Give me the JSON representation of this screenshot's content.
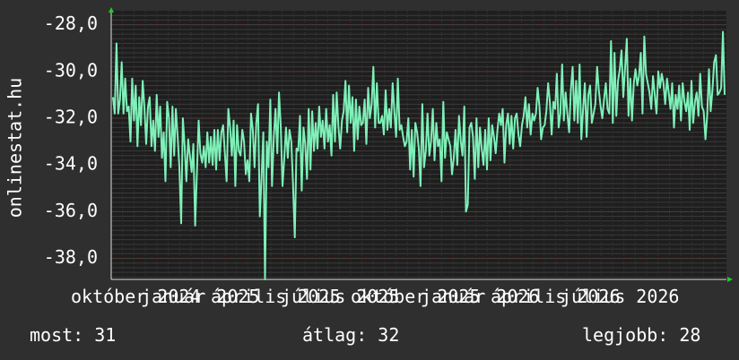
{
  "chart_data": {
    "type": "line",
    "ylabel": "onlinestat.hu",
    "ylim": [
      -38.9,
      -27.4
    ],
    "yticks": [
      -28.0,
      -30.0,
      -32.0,
      -34.0,
      -36.0,
      -38.0
    ],
    "ytick_labels": [
      "-28,0",
      "-30,0",
      "-32,0",
      "-34,0",
      "-36,0",
      "-38,0"
    ],
    "xtick_labels": [
      "október 2024",
      "január 2025",
      "április 2025",
      "július 2025",
      "október 2025",
      "január 2026",
      "április 2026",
      "július 2026"
    ],
    "grid": true,
    "series": [
      {
        "color": "#7ef0b8",
        "values": [
          -31.1,
          -31.8,
          -28.8,
          -31.8,
          -31.2,
          -29.6,
          -31.8,
          -30.3,
          -31.7,
          -31.5,
          -33.0,
          -30.3,
          -32.1,
          -30.6,
          -33.2,
          -31.1,
          -32.3,
          -30.4,
          -31.6,
          -33.1,
          -31.5,
          -31.1,
          -33.2,
          -32.1,
          -33.4,
          -31.0,
          -32.8,
          -31.5,
          -33.7,
          -32.6,
          -34.7,
          -31.3,
          -32.0,
          -34.1,
          -31.5,
          -33.6,
          -31.6,
          -32.8,
          -34.1,
          -36.5,
          -32.0,
          -33.2,
          -34.7,
          -32.9,
          -33.6,
          -34.3,
          -33.1,
          -36.6,
          -34.4,
          -32.1,
          -33.5,
          -33.9,
          -33.2,
          -34.1,
          -32.6,
          -33.9,
          -32.8,
          -34.0,
          -32.5,
          -34.2,
          -32.5,
          -33.8,
          -32.6,
          -32.3,
          -33.5,
          -34.7,
          -31.6,
          -32.4,
          -33.6,
          -32.1,
          -34.9,
          -32.3,
          -33.4,
          -33.6,
          -32.5,
          -33.0,
          -34.4,
          -33.8,
          -34.7,
          -31.8,
          -32.5,
          -34.1,
          -32.2,
          -31.4,
          -36.2,
          -34.6,
          -32.6,
          -38.9,
          -33.0,
          -34.1,
          -31.2,
          -34.9,
          -32.8,
          -31.6,
          -33.5,
          -30.9,
          -32.4,
          -34.9,
          -33.7,
          -32.4,
          -33.7,
          -32.5,
          -33.0,
          -34.8,
          -37.1,
          -33.3,
          -33.4,
          -31.9,
          -35.1,
          -32.4,
          -33.1,
          -34.6,
          -31.6,
          -34.2,
          -31.7,
          -33.4,
          -32.2,
          -33.3,
          -31.5,
          -32.8,
          -32.1,
          -33.3,
          -31.6,
          -33.0,
          -32.3,
          -33.6,
          -31.0,
          -33.0,
          -30.9,
          -32.4,
          -33.3,
          -32.1,
          -31.7,
          -30.4,
          -32.6,
          -30.6,
          -32.2,
          -31.1,
          -33.4,
          -31.2,
          -32.9,
          -31.5,
          -32.3,
          -32.2,
          -31.2,
          -33.1,
          -30.7,
          -32.0,
          -31.4,
          -29.8,
          -32.4,
          -30.5,
          -32.2,
          -32.2,
          -31.9,
          -32.7,
          -30.8,
          -32.5,
          -31.6,
          -32.4,
          -30.5,
          -31.7,
          -32.8,
          -30.3,
          -32.5,
          -32.3,
          -32.8,
          -33.2,
          -33.0,
          -32.0,
          -34.2,
          -32.5,
          -34.5,
          -32.2,
          -32.6,
          -33.3,
          -34.9,
          -31.4,
          -34.1,
          -33.4,
          -31.8,
          -33.6,
          -33.0,
          -31.6,
          -33.8,
          -32.2,
          -33.2,
          -32.9,
          -34.7,
          -31.3,
          -33.7,
          -32.6,
          -32.9,
          -33.2,
          -34.4,
          -33.7,
          -32.5,
          -34.0,
          -31.9,
          -33.0,
          -33.6,
          -31.5,
          -36.0,
          -35.7,
          -32.4,
          -32.2,
          -32.8,
          -34.6,
          -32.0,
          -34.1,
          -32.4,
          -33.3,
          -34.0,
          -32.5,
          -34.2,
          -32.0,
          -33.8,
          -32.3,
          -32.8,
          -33.5,
          -32.5,
          -31.8,
          -32.3,
          -31.6,
          -33.9,
          -32.3,
          -31.8,
          -33.1,
          -31.9,
          -33.3,
          -32.0,
          -31.8,
          -32.7,
          -33.2,
          -32.3,
          -31.9,
          -31.1,
          -32.4,
          -31.4,
          -32.7,
          -31.8,
          -32.1,
          -31.8,
          -30.7,
          -31.5,
          -32.9,
          -32.4,
          -32.3,
          -31.7,
          -30.5,
          -31.3,
          -32.7,
          -31.3,
          -31.6,
          -30.1,
          -32.4,
          -31.8,
          -29.7,
          -32.1,
          -30.9,
          -31.8,
          -32.6,
          -30.8,
          -29.8,
          -32.1,
          -30.4,
          -32.2,
          -29.7,
          -32.9,
          -31.6,
          -30.5,
          -32.8,
          -31.0,
          -30.6,
          -32.2,
          -31.8,
          -31.4,
          -29.8,
          -30.8,
          -31.5,
          -32.0,
          -31.2,
          -30.5,
          -31.6,
          -31.8,
          -28.7,
          -32.2,
          -29.2,
          -31.9,
          -30.4,
          -29.9,
          -29.1,
          -31.1,
          -29.9,
          -28.6,
          -31.9,
          -30.3,
          -32.1,
          -30.5,
          -29.9,
          -30.6,
          -30.2,
          -29.2,
          -31.8,
          -28.5,
          -30.1,
          -30.5,
          -30.9,
          -31.6,
          -30.2,
          -31.0,
          -31.8,
          -30.0,
          -30.7,
          -30.1,
          -30.5,
          -31.4,
          -30.3,
          -30.9,
          -31.6,
          -30.5,
          -32.4,
          -31.0,
          -31.6,
          -30.6,
          -32.1,
          -30.5,
          -31.3,
          -31.7,
          -30.9,
          -32.5,
          -30.4,
          -32.2,
          -31.3,
          -30.9,
          -31.9,
          -30.1,
          -31.5,
          -31.7,
          -32.9,
          -31.9,
          -29.9,
          -31.7,
          -30.8,
          -29.6,
          -29.3,
          -31.0,
          -30.9,
          -30.7,
          -28.3,
          -31.0
        ]
      }
    ]
  },
  "stats": {
    "current": "most: 31",
    "average": "átlag: 32",
    "best": "legjobb: 28"
  }
}
